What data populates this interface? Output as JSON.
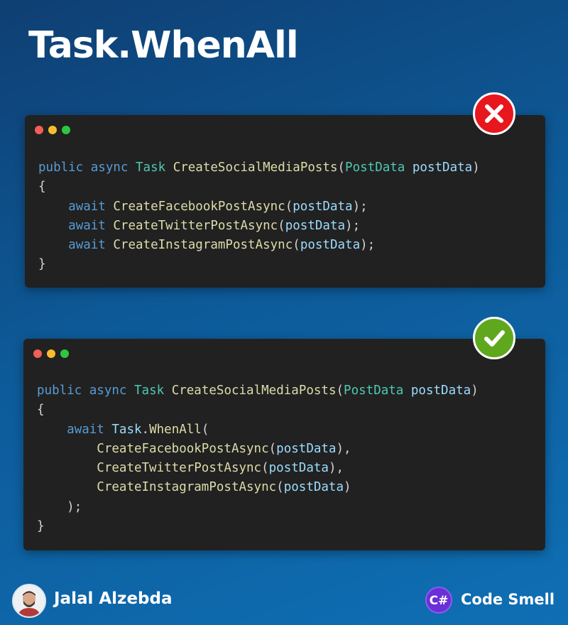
{
  "title": "Task.WhenAll",
  "bad_example": {
    "status_icon": "x-icon",
    "lines": [
      [
        {
          "t": "public",
          "c": "kw"
        },
        {
          "t": " ",
          "c": "pn"
        },
        {
          "t": "async",
          "c": "kw"
        },
        {
          "t": " ",
          "c": "pn"
        },
        {
          "t": "Task",
          "c": "ty"
        },
        {
          "t": " ",
          "c": "pn"
        },
        {
          "t": "CreateSocialMediaPosts",
          "c": "fn"
        },
        {
          "t": "(",
          "c": "pn"
        },
        {
          "t": "PostData",
          "c": "ty"
        },
        {
          "t": " ",
          "c": "pn"
        },
        {
          "t": "postData",
          "c": "pm"
        },
        {
          "t": ")",
          "c": "pn"
        }
      ],
      [
        {
          "t": "{",
          "c": "pn"
        }
      ],
      [
        {
          "t": "    ",
          "c": "pn"
        },
        {
          "t": "await",
          "c": "aw"
        },
        {
          "t": " ",
          "c": "pn"
        },
        {
          "t": "CreateFacebookPostAsync",
          "c": "fn"
        },
        {
          "t": "(",
          "c": "pn"
        },
        {
          "t": "postData",
          "c": "pm"
        },
        {
          "t": ");",
          "c": "pn"
        }
      ],
      [
        {
          "t": "    ",
          "c": "pn"
        },
        {
          "t": "await",
          "c": "aw"
        },
        {
          "t": " ",
          "c": "pn"
        },
        {
          "t": "CreateTwitterPostAsync",
          "c": "fn"
        },
        {
          "t": "(",
          "c": "pn"
        },
        {
          "t": "postData",
          "c": "pm"
        },
        {
          "t": ");",
          "c": "pn"
        }
      ],
      [
        {
          "t": "    ",
          "c": "pn"
        },
        {
          "t": "await",
          "c": "aw"
        },
        {
          "t": " ",
          "c": "pn"
        },
        {
          "t": "CreateInstagramPostAsync",
          "c": "fn"
        },
        {
          "t": "(",
          "c": "pn"
        },
        {
          "t": "postData",
          "c": "pm"
        },
        {
          "t": ");",
          "c": "pn"
        }
      ],
      [
        {
          "t": "}",
          "c": "pn"
        }
      ]
    ]
  },
  "good_example": {
    "status_icon": "checkmark-icon",
    "lines": [
      [
        {
          "t": "public",
          "c": "kw"
        },
        {
          "t": " ",
          "c": "pn"
        },
        {
          "t": "async",
          "c": "kw"
        },
        {
          "t": " ",
          "c": "pn"
        },
        {
          "t": "Task",
          "c": "ty"
        },
        {
          "t": " ",
          "c": "pn"
        },
        {
          "t": "CreateSocialMediaPosts",
          "c": "fn"
        },
        {
          "t": "(",
          "c": "pn"
        },
        {
          "t": "PostData",
          "c": "ty"
        },
        {
          "t": " ",
          "c": "pn"
        },
        {
          "t": "postData",
          "c": "pm"
        },
        {
          "t": ")",
          "c": "pn"
        }
      ],
      [
        {
          "t": "{",
          "c": "pn"
        }
      ],
      [
        {
          "t": "    ",
          "c": "pn"
        },
        {
          "t": "await",
          "c": "aw"
        },
        {
          "t": " ",
          "c": "pn"
        },
        {
          "t": "Task",
          "c": "pm"
        },
        {
          "t": ".",
          "c": "pn"
        },
        {
          "t": "WhenAll",
          "c": "fn"
        },
        {
          "t": "(",
          "c": "pn"
        }
      ],
      [
        {
          "t": "        ",
          "c": "pn"
        },
        {
          "t": "CreateFacebookPostAsync",
          "c": "fn"
        },
        {
          "t": "(",
          "c": "pn"
        },
        {
          "t": "postData",
          "c": "pm"
        },
        {
          "t": "),",
          "c": "pn"
        }
      ],
      [
        {
          "t": "        ",
          "c": "pn"
        },
        {
          "t": "CreateTwitterPostAsync",
          "c": "fn"
        },
        {
          "t": "(",
          "c": "pn"
        },
        {
          "t": "postData",
          "c": "pm"
        },
        {
          "t": "),",
          "c": "pn"
        }
      ],
      [
        {
          "t": "        ",
          "c": "pn"
        },
        {
          "t": "CreateInstagramPostAsync",
          "c": "fn"
        },
        {
          "t": "(",
          "c": "pn"
        },
        {
          "t": "postData",
          "c": "pm"
        },
        {
          "t": ")",
          "c": "pn"
        }
      ],
      [
        {
          "t": "    ",
          "c": "pn"
        },
        {
          "t": ");",
          "c": "pn"
        }
      ],
      [
        {
          "t": "}",
          "c": "pn"
        }
      ]
    ]
  },
  "footer": {
    "author": "Jalal Alzebda",
    "brand": "Code Smell",
    "logo_text": "C#"
  },
  "colors": {
    "keyword": "#569cd6",
    "type": "#4ec9b0",
    "function": "#dcdcaa",
    "parameter": "#9cdcfe",
    "bad": "#e8161d",
    "good": "#5fa81e"
  }
}
